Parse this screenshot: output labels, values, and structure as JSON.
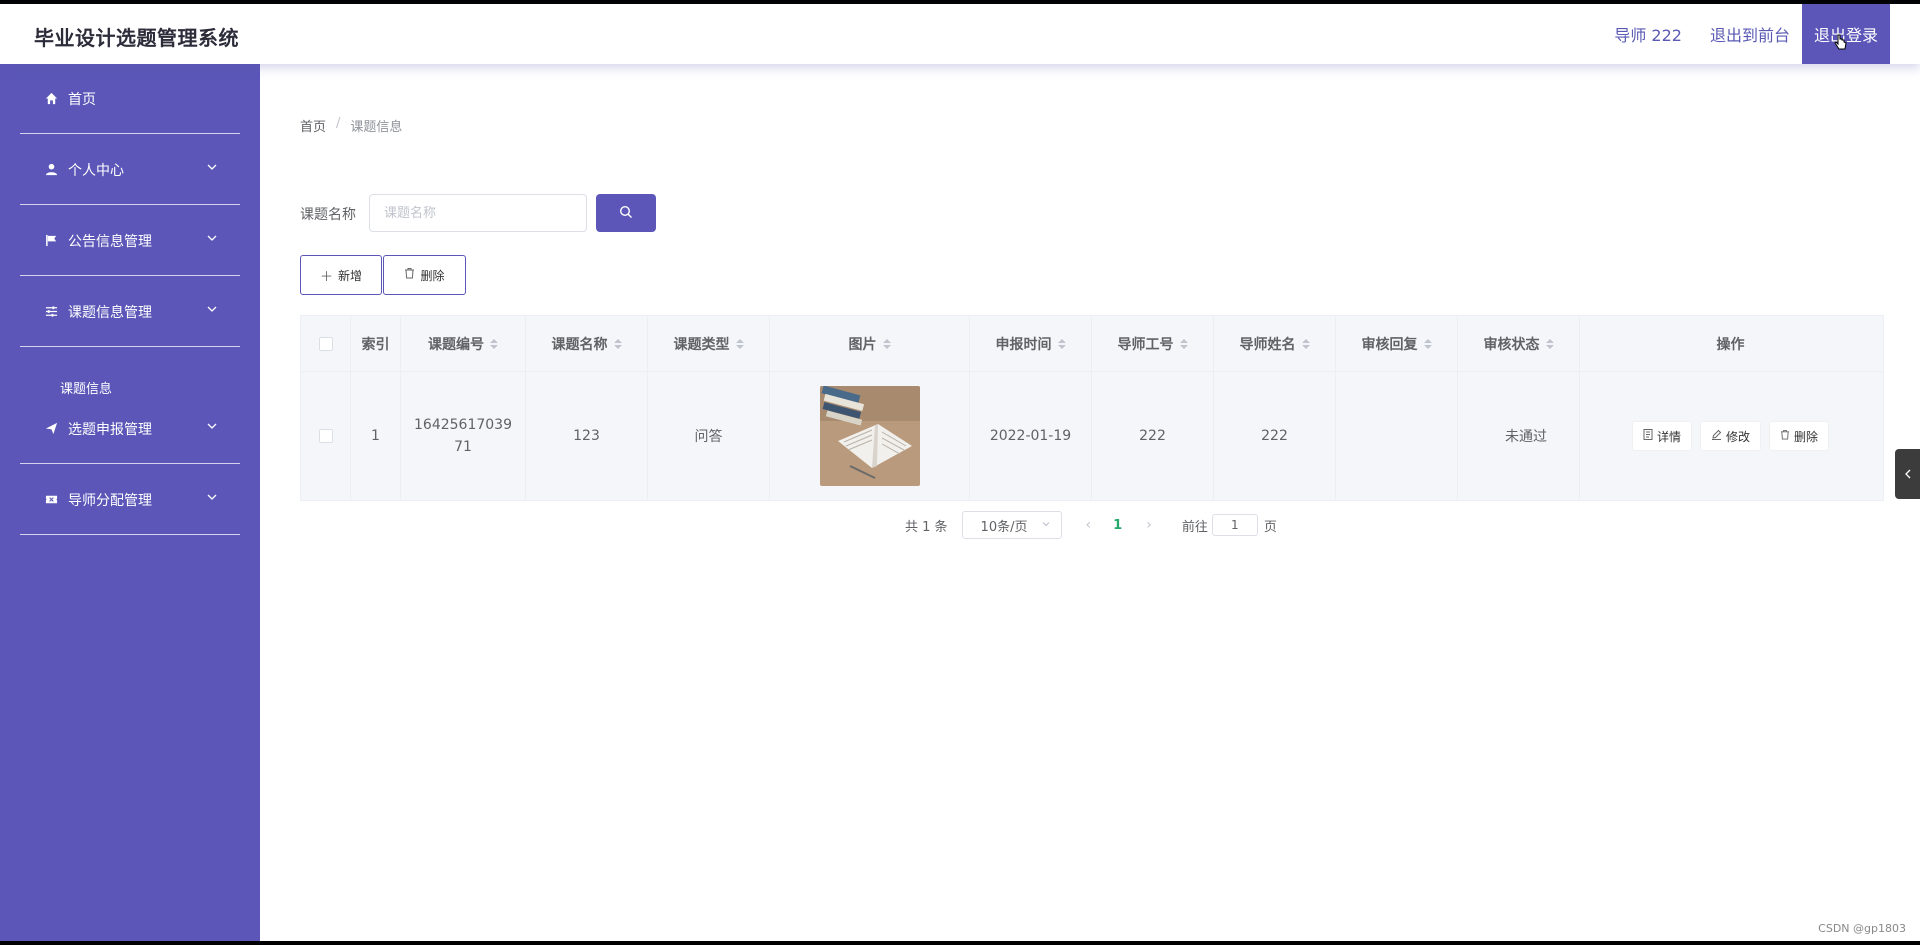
{
  "app": {
    "title": "毕业设计选题管理系统"
  },
  "header": {
    "user": "导师 222",
    "front_link": "退出到前台",
    "logout": "退出登录"
  },
  "sidebar": {
    "items": [
      {
        "label": "首页",
        "icon": "home-icon"
      },
      {
        "label": "个人中心",
        "icon": "user-icon"
      },
      {
        "label": "公告信息管理",
        "icon": "flag-icon"
      },
      {
        "label": "课题信息管理",
        "icon": "sliders-icon"
      },
      {
        "label": "选题申报管理",
        "icon": "send-icon"
      },
      {
        "label": "导师分配管理",
        "icon": "ticket-icon"
      }
    ],
    "sub_item": "课题信息"
  },
  "breadcrumb": {
    "home": "首页",
    "sep": "/",
    "current": "课题信息"
  },
  "search": {
    "label": "课题名称",
    "placeholder": "课题名称"
  },
  "toolbar": {
    "add": "新增",
    "delete": "删除"
  },
  "table": {
    "headers": [
      "索引",
      "课题编号",
      "课题名称",
      "课题类型",
      "图片",
      "申报时间",
      "导师工号",
      "导师姓名",
      "审核回复",
      "审核状态",
      "操作"
    ],
    "rows": [
      {
        "index": "1",
        "code": "1642561703971",
        "name": "123",
        "type": "问答",
        "date": "2022-01-19",
        "teacher_id": "222",
        "teacher_name": "222",
        "reply": "",
        "status": "未通过"
      }
    ],
    "actions": {
      "detail": "详情",
      "edit": "修改",
      "delete": "删除"
    }
  },
  "pagination": {
    "total": "共 1 条",
    "page_size": "10条/页",
    "current_page": "1",
    "goto_label": "前往",
    "goto_value": "1",
    "page_suffix": "页"
  },
  "watermark": "CSDN @gp1803",
  "colors": {
    "primary": "#5b56b8",
    "active_page": "#26a96c"
  }
}
